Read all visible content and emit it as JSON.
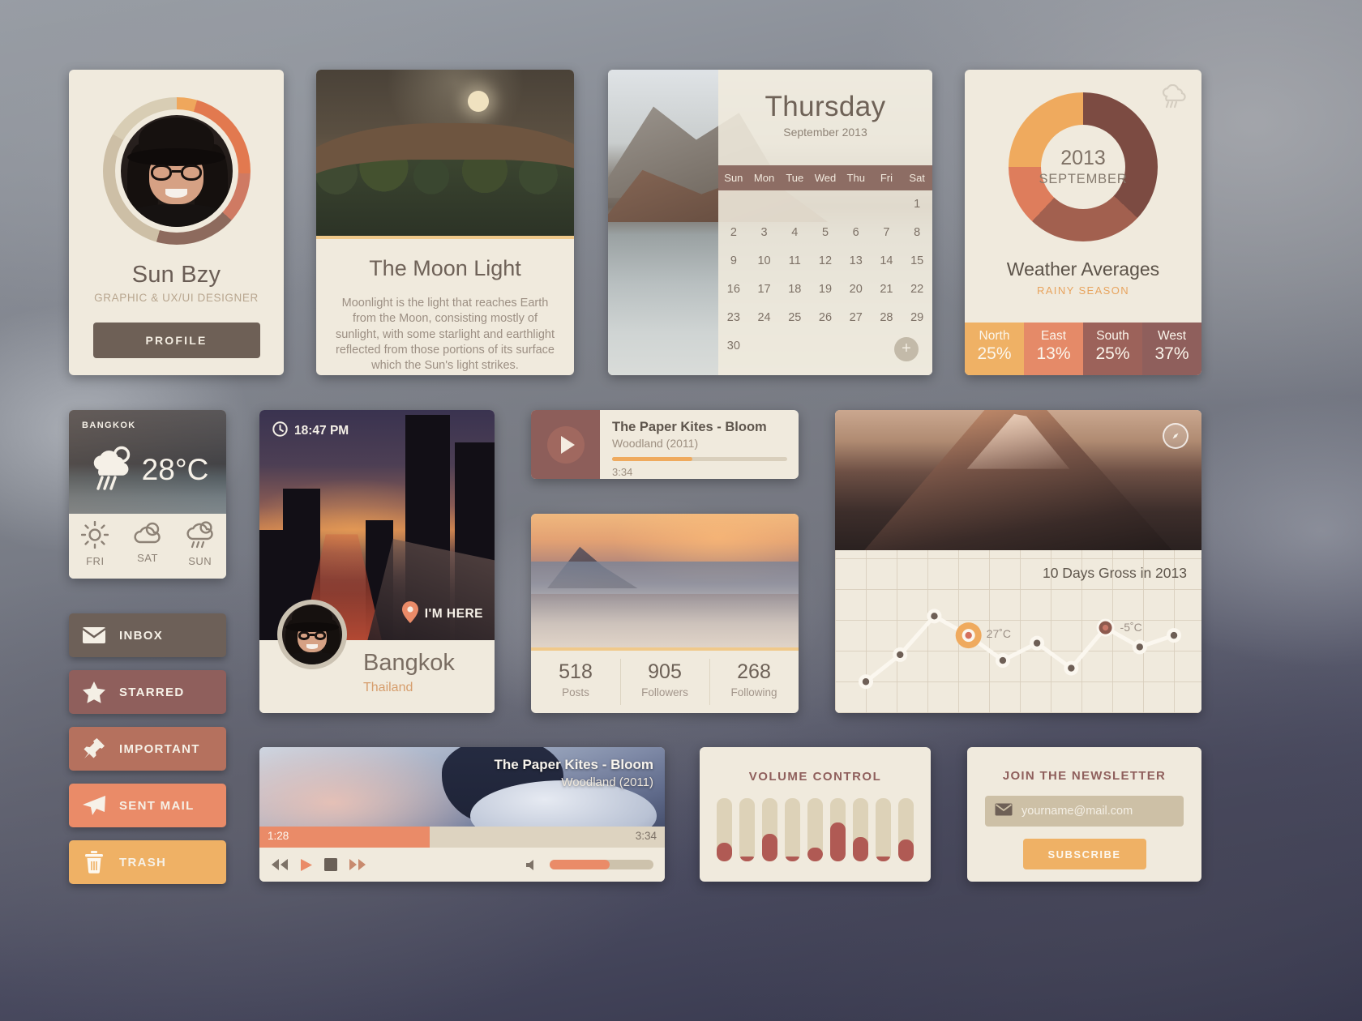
{
  "profile": {
    "name": "Sun Bzy",
    "role": "GRAPHIC & UX/UI DESIGNER",
    "button": "PROFILE"
  },
  "moon": {
    "title": "The Moon Light",
    "body": "Moonlight is the light that reaches Earth from the Moon, consisting mostly of sunlight, with some starlight and earthlight reflected from those portions of its surface which the Sun's light strikes."
  },
  "calendar": {
    "day": "Thursday",
    "subtitle": "September 2013",
    "dow": [
      "Sun",
      "Mon",
      "Tue",
      "Wed",
      "Thu",
      "Fri",
      "Sat"
    ],
    "cells": [
      "",
      "",
      "",
      "",
      "",
      "",
      "1",
      "2",
      "3",
      "4",
      "5",
      "6",
      "7",
      "8",
      "9",
      "10",
      "11",
      "12",
      "13",
      "14",
      "15",
      "16",
      "17",
      "18",
      "19",
      "20",
      "21",
      "22",
      "23",
      "24",
      "25",
      "26",
      "27",
      "28",
      "29",
      "30",
      "",
      "",
      "",
      "",
      "",
      ""
    ],
    "add_label": "+"
  },
  "weather_avg": {
    "year": "2013",
    "month": "SEPTEMBER",
    "title": "Weather Averages",
    "subtitle": "RAINY SEASON",
    "regions": [
      {
        "name": "North",
        "value": "25%",
        "color": "#efb165"
      },
      {
        "name": "East",
        "value": "13%",
        "color": "#e58a68"
      },
      {
        "name": "South",
        "value": "25%",
        "color": "#9c625a"
      },
      {
        "name": "West",
        "value": "37%",
        "color": "#8f5f5c"
      }
    ],
    "chart_data": {
      "type": "pie",
      "title": "Weather Averages",
      "categories": [
        "West",
        "South",
        "East",
        "North"
      ],
      "values": [
        37,
        25,
        13,
        25
      ],
      "colors": [
        "#7c4b42",
        "#a2604f",
        "#de7d5c",
        "#efaa5e"
      ],
      "legend": "bottom"
    }
  },
  "bangkok_weather": {
    "city": "BANGKOK",
    "temp": "28",
    "unit": "°C",
    "days": [
      {
        "label": "FRI",
        "icon": "sun-icon"
      },
      {
        "label": "SAT",
        "icon": "cloud-icon"
      },
      {
        "label": "SUN",
        "icon": "rain-cloud-icon"
      }
    ]
  },
  "mail": {
    "items": [
      {
        "label": "INBOX",
        "icon": "envelope-icon",
        "color": "#6d6058"
      },
      {
        "label": "STARRED",
        "icon": "star-icon",
        "color": "#8f5f5c"
      },
      {
        "label": "IMPORTANT",
        "icon": "pin-icon",
        "color": "#b5715e"
      },
      {
        "label": "SENT MAIL",
        "icon": "send-icon",
        "color": "#ea8b68"
      },
      {
        "label": "TRASH",
        "icon": "trash-icon",
        "color": "#efb165"
      }
    ]
  },
  "city": {
    "time": "18:47 PM",
    "here_label": "I'M HERE",
    "name": "Bangkok",
    "country": "Thailand"
  },
  "music": {
    "title": "The Paper Kites - Bloom",
    "album": "Woodland (2011)",
    "time": "3:34",
    "progress_pct": 46
  },
  "social": {
    "stats": [
      {
        "value": "518",
        "label": "Posts"
      },
      {
        "value": "905",
        "label": "Followers"
      },
      {
        "value": "268",
        "label": "Following"
      }
    ]
  },
  "chart": {
    "title": "10 Days Gross in 2013",
    "high_label": "27˚C",
    "low_label": "-5˚C",
    "chart_data": {
      "type": "line",
      "title": "10 Days Gross in 2013",
      "x": [
        1,
        2,
        3,
        4,
        5,
        6,
        7,
        8,
        9,
        10
      ],
      "values": [
        4,
        32,
        72,
        52,
        26,
        44,
        18,
        60,
        40,
        52
      ],
      "point_labels": {
        "3": "27˚C",
        "7": "-5˚C"
      },
      "highlight_high_index": 3,
      "highlight_low_index": 7,
      "grid": true,
      "xlabel": "",
      "ylabel": "",
      "ylim": [
        0,
        100
      ]
    }
  },
  "video": {
    "title": "The Paper Kites - Bloom",
    "album": "Woodland (2011)",
    "time_elapsed": "1:28",
    "time_total": "3:34",
    "progress_pct": 42,
    "volume_pct": 58,
    "controls": [
      {
        "name": "rewind-button",
        "glyph": "◀◀"
      },
      {
        "name": "play-button",
        "glyph": "▶"
      },
      {
        "name": "stop-button",
        "glyph": "■"
      },
      {
        "name": "forward-button",
        "glyph": "▶▶"
      }
    ]
  },
  "volume": {
    "title": "VOLUME CONTROL",
    "chart_data": {
      "type": "bar",
      "title": "VOLUME CONTROL",
      "categories": [
        "1",
        "2",
        "3",
        "4",
        "5",
        "6",
        "7",
        "8",
        "9"
      ],
      "values": [
        30,
        8,
        44,
        8,
        22,
        62,
        38,
        8,
        34
      ],
      "ylim": [
        0,
        100
      ],
      "grid": false
    }
  },
  "newsletter": {
    "title": "JOIN THE NEWSLETTER",
    "placeholder": "yourname@mail.com",
    "value": "",
    "button": "SUBSCRIBE"
  }
}
